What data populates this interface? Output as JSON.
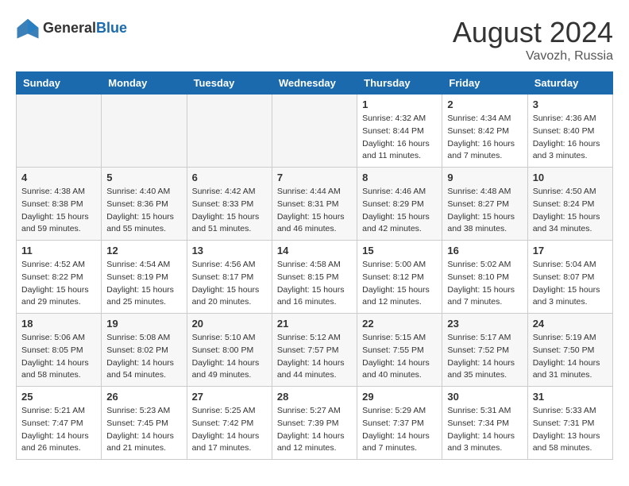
{
  "header": {
    "logo_general": "General",
    "logo_blue": "Blue",
    "month_title": "August 2024",
    "location": "Vavozh, Russia"
  },
  "days_of_week": [
    "Sunday",
    "Monday",
    "Tuesday",
    "Wednesday",
    "Thursday",
    "Friday",
    "Saturday"
  ],
  "weeks": [
    [
      {
        "day": "",
        "empty": true
      },
      {
        "day": "",
        "empty": true
      },
      {
        "day": "",
        "empty": true
      },
      {
        "day": "",
        "empty": true
      },
      {
        "day": "1",
        "sunrise": "4:32 AM",
        "sunset": "8:44 PM",
        "daylight": "16 hours and 11 minutes."
      },
      {
        "day": "2",
        "sunrise": "4:34 AM",
        "sunset": "8:42 PM",
        "daylight": "16 hours and 7 minutes."
      },
      {
        "day": "3",
        "sunrise": "4:36 AM",
        "sunset": "8:40 PM",
        "daylight": "16 hours and 3 minutes."
      }
    ],
    [
      {
        "day": "4",
        "sunrise": "4:38 AM",
        "sunset": "8:38 PM",
        "daylight": "15 hours and 59 minutes."
      },
      {
        "day": "5",
        "sunrise": "4:40 AM",
        "sunset": "8:36 PM",
        "daylight": "15 hours and 55 minutes."
      },
      {
        "day": "6",
        "sunrise": "4:42 AM",
        "sunset": "8:33 PM",
        "daylight": "15 hours and 51 minutes."
      },
      {
        "day": "7",
        "sunrise": "4:44 AM",
        "sunset": "8:31 PM",
        "daylight": "15 hours and 46 minutes."
      },
      {
        "day": "8",
        "sunrise": "4:46 AM",
        "sunset": "8:29 PM",
        "daylight": "15 hours and 42 minutes."
      },
      {
        "day": "9",
        "sunrise": "4:48 AM",
        "sunset": "8:27 PM",
        "daylight": "15 hours and 38 minutes."
      },
      {
        "day": "10",
        "sunrise": "4:50 AM",
        "sunset": "8:24 PM",
        "daylight": "15 hours and 34 minutes."
      }
    ],
    [
      {
        "day": "11",
        "sunrise": "4:52 AM",
        "sunset": "8:22 PM",
        "daylight": "15 hours and 29 minutes."
      },
      {
        "day": "12",
        "sunrise": "4:54 AM",
        "sunset": "8:19 PM",
        "daylight": "15 hours and 25 minutes."
      },
      {
        "day": "13",
        "sunrise": "4:56 AM",
        "sunset": "8:17 PM",
        "daylight": "15 hours and 20 minutes."
      },
      {
        "day": "14",
        "sunrise": "4:58 AM",
        "sunset": "8:15 PM",
        "daylight": "15 hours and 16 minutes."
      },
      {
        "day": "15",
        "sunrise": "5:00 AM",
        "sunset": "8:12 PM",
        "daylight": "15 hours and 12 minutes."
      },
      {
        "day": "16",
        "sunrise": "5:02 AM",
        "sunset": "8:10 PM",
        "daylight": "15 hours and 7 minutes."
      },
      {
        "day": "17",
        "sunrise": "5:04 AM",
        "sunset": "8:07 PM",
        "daylight": "15 hours and 3 minutes."
      }
    ],
    [
      {
        "day": "18",
        "sunrise": "5:06 AM",
        "sunset": "8:05 PM",
        "daylight": "14 hours and 58 minutes."
      },
      {
        "day": "19",
        "sunrise": "5:08 AM",
        "sunset": "8:02 PM",
        "daylight": "14 hours and 54 minutes."
      },
      {
        "day": "20",
        "sunrise": "5:10 AM",
        "sunset": "8:00 PM",
        "daylight": "14 hours and 49 minutes."
      },
      {
        "day": "21",
        "sunrise": "5:12 AM",
        "sunset": "7:57 PM",
        "daylight": "14 hours and 44 minutes."
      },
      {
        "day": "22",
        "sunrise": "5:15 AM",
        "sunset": "7:55 PM",
        "daylight": "14 hours and 40 minutes."
      },
      {
        "day": "23",
        "sunrise": "5:17 AM",
        "sunset": "7:52 PM",
        "daylight": "14 hours and 35 minutes."
      },
      {
        "day": "24",
        "sunrise": "5:19 AM",
        "sunset": "7:50 PM",
        "daylight": "14 hours and 31 minutes."
      }
    ],
    [
      {
        "day": "25",
        "sunrise": "5:21 AM",
        "sunset": "7:47 PM",
        "daylight": "14 hours and 26 minutes."
      },
      {
        "day": "26",
        "sunrise": "5:23 AM",
        "sunset": "7:45 PM",
        "daylight": "14 hours and 21 minutes."
      },
      {
        "day": "27",
        "sunrise": "5:25 AM",
        "sunset": "7:42 PM",
        "daylight": "14 hours and 17 minutes."
      },
      {
        "day": "28",
        "sunrise": "5:27 AM",
        "sunset": "7:39 PM",
        "daylight": "14 hours and 12 minutes."
      },
      {
        "day": "29",
        "sunrise": "5:29 AM",
        "sunset": "7:37 PM",
        "daylight": "14 hours and 7 minutes."
      },
      {
        "day": "30",
        "sunrise": "5:31 AM",
        "sunset": "7:34 PM",
        "daylight": "14 hours and 3 minutes."
      },
      {
        "day": "31",
        "sunrise": "5:33 AM",
        "sunset": "7:31 PM",
        "daylight": "13 hours and 58 minutes."
      }
    ]
  ]
}
